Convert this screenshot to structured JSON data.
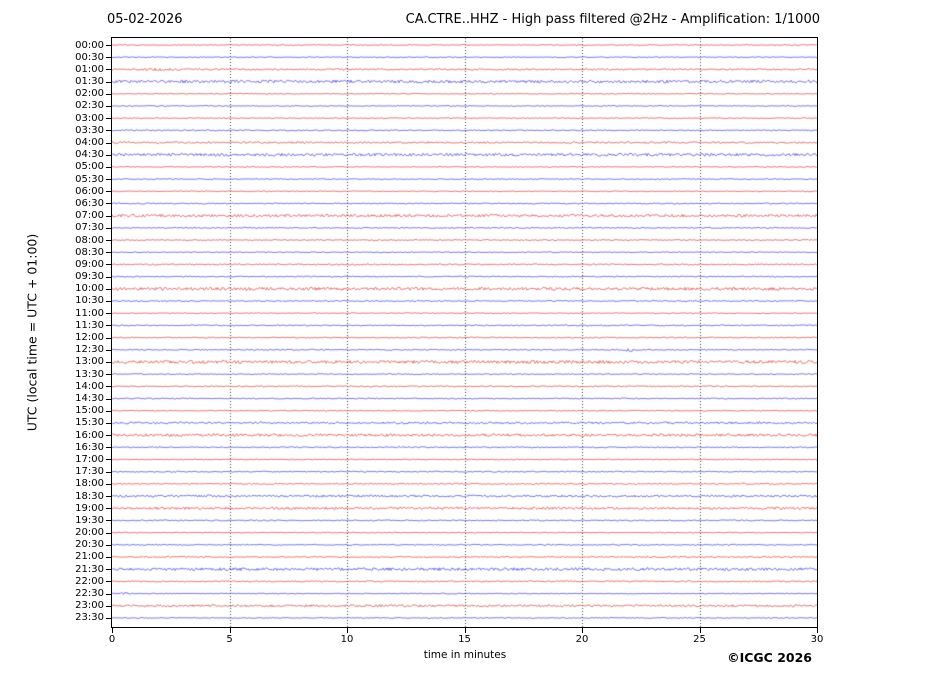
{
  "header": {
    "date": "05-02-2026",
    "title": "CA.CTRE..HHZ - High pass filtered @2Hz - Amplification: 1/1000"
  },
  "axes": {
    "x_label": "time in minutes",
    "y_label": "UTC (local time = UTC + 01:00)",
    "x_ticks": [
      "0",
      "5",
      "10",
      "15",
      "20",
      "25",
      "30"
    ],
    "x_range": [
      0,
      30
    ],
    "x_grid_minutes": [
      5,
      10,
      15,
      20,
      25
    ],
    "grid_style": "dotted-vertical"
  },
  "footer": {
    "copyright": "©ICGC 2026"
  },
  "colors": {
    "trace_red": "#e05050",
    "trace_blue": "#5050e0",
    "grid": "#444444",
    "frame": "#000000",
    "text": "#000000",
    "background": "#ffffff"
  },
  "chart_data": {
    "type": "line",
    "subtype": "helicorder-dayplot",
    "title": "CA.CTRE..HHZ - High pass filtered @2Hz - Amplification: 1/1000",
    "date": "05-02-2026",
    "station": "CA.CTRE..HHZ",
    "filter": "High pass filtered @2Hz",
    "amplification": "1/1000",
    "xlabel": "time in minutes",
    "ylabel": "UTC (local time = UTC + 01:00)",
    "minutes_per_line": 30,
    "x_range": [
      0,
      30
    ],
    "legend": "none",
    "grid": "vertical dotted lines every 5 minutes",
    "rows": [
      {
        "label": "00:00",
        "color": "red",
        "noise_amp": 0.5
      },
      {
        "label": "00:30",
        "color": "blue",
        "noise_amp": 0.5
      },
      {
        "label": "01:00",
        "color": "red",
        "noise_amp": 0.8
      },
      {
        "label": "01:30",
        "color": "blue",
        "noise_amp": 1.4
      },
      {
        "label": "02:00",
        "color": "red",
        "noise_amp": 0.5
      },
      {
        "label": "02:30",
        "color": "blue",
        "noise_amp": 0.5
      },
      {
        "label": "03:00",
        "color": "red",
        "noise_amp": 0.5
      },
      {
        "label": "03:30",
        "color": "blue",
        "noise_amp": 0.6
      },
      {
        "label": "04:00",
        "color": "red",
        "noise_amp": 0.9
      },
      {
        "label": "04:30",
        "color": "blue",
        "noise_amp": 1.4
      },
      {
        "label": "05:00",
        "color": "red",
        "noise_amp": 0.5
      },
      {
        "label": "05:30",
        "color": "blue",
        "noise_amp": 0.5
      },
      {
        "label": "06:00",
        "color": "red",
        "noise_amp": 0.5
      },
      {
        "label": "06:30",
        "color": "blue",
        "noise_amp": 0.6
      },
      {
        "label": "07:00",
        "color": "red",
        "noise_amp": 1.3
      },
      {
        "label": "07:30",
        "color": "blue",
        "noise_amp": 0.6
      },
      {
        "label": "08:00",
        "color": "red",
        "noise_amp": 0.6
      },
      {
        "label": "08:30",
        "color": "blue",
        "noise_amp": 0.5
      },
      {
        "label": "09:00",
        "color": "red",
        "noise_amp": 0.7
      },
      {
        "label": "09:30",
        "color": "blue",
        "noise_amp": 0.6
      },
      {
        "label": "10:00",
        "color": "red",
        "noise_amp": 1.5
      },
      {
        "label": "10:30",
        "color": "blue",
        "noise_amp": 0.6
      },
      {
        "label": "11:00",
        "color": "red",
        "noise_amp": 0.5
      },
      {
        "label": "11:30",
        "color": "blue",
        "noise_amp": 0.6
      },
      {
        "label": "12:00",
        "color": "red",
        "noise_amp": 0.6
      },
      {
        "label": "12:30",
        "color": "blue",
        "noise_amp": 0.6
      },
      {
        "label": "13:00",
        "color": "red",
        "noise_amp": 1.5
      },
      {
        "label": "13:30",
        "color": "blue",
        "noise_amp": 0.5
      },
      {
        "label": "14:00",
        "color": "red",
        "noise_amp": 0.6
      },
      {
        "label": "14:30",
        "color": "blue",
        "noise_amp": 0.6
      },
      {
        "label": "15:00",
        "color": "red",
        "noise_amp": 0.5
      },
      {
        "label": "15:30",
        "color": "blue",
        "noise_amp": 1.0
      },
      {
        "label": "16:00",
        "color": "red",
        "noise_amp": 1.3
      },
      {
        "label": "16:30",
        "color": "blue",
        "noise_amp": 0.6
      },
      {
        "label": "17:00",
        "color": "red",
        "noise_amp": 0.5
      },
      {
        "label": "17:30",
        "color": "blue",
        "noise_amp": 0.6
      },
      {
        "label": "18:00",
        "color": "red",
        "noise_amp": 0.7
      },
      {
        "label": "18:30",
        "color": "blue",
        "noise_amp": 1.1
      },
      {
        "label": "19:00",
        "color": "red",
        "noise_amp": 1.2
      },
      {
        "label": "19:30",
        "color": "blue",
        "noise_amp": 0.6
      },
      {
        "label": "20:00",
        "color": "red",
        "noise_amp": 0.5
      },
      {
        "label": "20:30",
        "color": "blue",
        "noise_amp": 0.6
      },
      {
        "label": "21:00",
        "color": "red",
        "noise_amp": 0.6
      },
      {
        "label": "21:30",
        "color": "blue",
        "noise_amp": 1.4
      },
      {
        "label": "22:00",
        "color": "red",
        "noise_amp": 0.7
      },
      {
        "label": "22:30",
        "color": "blue",
        "noise_amp": 0.5
      },
      {
        "label": "23:00",
        "color": "red",
        "noise_amp": 1.1
      },
      {
        "label": "23:30",
        "color": "blue",
        "noise_amp": 0.5
      }
    ],
    "events": [
      {
        "row": "01:00",
        "start_min": 1.2,
        "end_min": 2.9,
        "extra_amp": 0.7
      },
      {
        "row": "12:30",
        "start_min": 21.7,
        "end_min": 22.3,
        "extra_amp": 1.6
      },
      {
        "row": "22:30",
        "start_min": 0.3,
        "end_min": 0.9,
        "extra_amp": 1.2
      }
    ]
  }
}
